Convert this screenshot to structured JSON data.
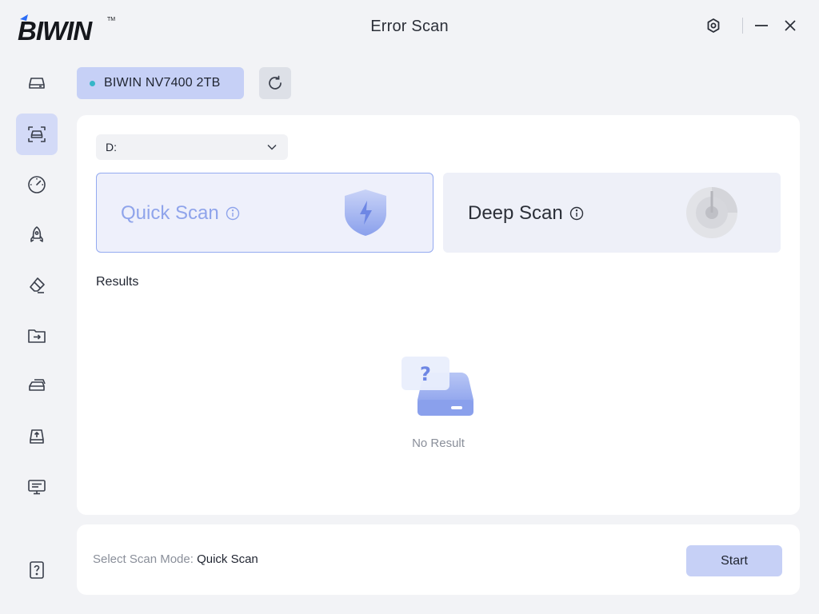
{
  "app": {
    "logo_text": "BIWIN",
    "title": "Error Scan"
  },
  "window_controls": [
    {
      "name": "settings-button",
      "icon": "gear-icon"
    },
    {
      "name": "minimize-button",
      "icon": "minus-icon"
    },
    {
      "name": "close-button",
      "icon": "close-icon"
    }
  ],
  "sidebar": {
    "items": [
      {
        "icon": "drive-icon",
        "active": false
      },
      {
        "icon": "drive-scan-icon",
        "active": true
      },
      {
        "icon": "speedometer-icon",
        "active": false
      },
      {
        "icon": "rocket-icon",
        "active": false
      },
      {
        "icon": "eraser-icon",
        "active": false
      },
      {
        "icon": "folder-transfer-icon",
        "active": false
      },
      {
        "icon": "drive-clone-icon",
        "active": false
      },
      {
        "icon": "firmware-upload-icon",
        "active": false
      },
      {
        "icon": "monitor-icon",
        "active": false
      }
    ],
    "help_icon": "help-icon"
  },
  "device": {
    "name": "BIWIN NV7400 2TB",
    "status_color": "#35b6c8"
  },
  "drive_select": {
    "value": "D:"
  },
  "scan_modes": {
    "quick": {
      "label": "Quick Scan",
      "selected": true
    },
    "deep": {
      "label": "Deep Scan",
      "selected": false
    }
  },
  "results": {
    "label": "Results",
    "empty_text": "No Result"
  },
  "footer": {
    "mode_label": "Select Scan Mode:",
    "mode_value": "Quick Scan",
    "start_label": "Start"
  },
  "colors": {
    "accent": "#c6d0f6",
    "accent_border": "#94aaf0",
    "quick_text": "#8fa4eb",
    "background": "#f2f3f6"
  }
}
